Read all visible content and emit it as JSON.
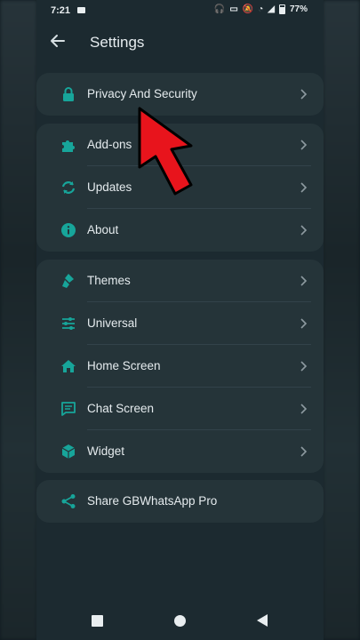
{
  "status_bar": {
    "time": "7:21",
    "battery": "77%"
  },
  "header": {
    "title": "Settings",
    "back_icon": "arrow-left-icon"
  },
  "groups": [
    {
      "items": [
        {
          "label": "Privacy And Security",
          "icon": "lock-icon"
        }
      ]
    },
    {
      "items": [
        {
          "label": "Add-ons",
          "icon": "puzzle-icon"
        },
        {
          "label": "Updates",
          "icon": "refresh-icon"
        },
        {
          "label": "About",
          "icon": "info-icon"
        }
      ]
    },
    {
      "items": [
        {
          "label": "Themes",
          "icon": "brush-icon"
        },
        {
          "label": "Universal",
          "icon": "sliders-icon"
        },
        {
          "label": "Home Screen",
          "icon": "home-icon"
        },
        {
          "label": "Chat Screen",
          "icon": "chat-icon"
        },
        {
          "label": "Widget",
          "icon": "cube-icon"
        }
      ]
    },
    {
      "items": [
        {
          "label": "Share GBWhatsApp Pro",
          "icon": "share-icon"
        }
      ]
    }
  ],
  "colors": {
    "accent": "#17a59a",
    "background": "#1c2a30",
    "card": "#253439",
    "annotation_arrow": "#e8141c"
  }
}
